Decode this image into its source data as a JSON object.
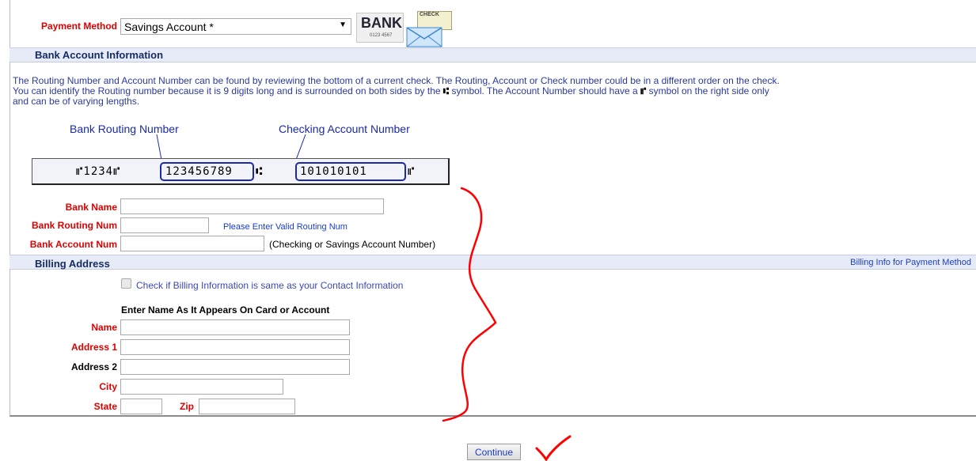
{
  "payment": {
    "label": "Payment Method",
    "selected": "Savings Account *",
    "bank_icon_text": "BANK",
    "bank_icon_subtext": "0123 4567",
    "check_icon_text": "CHECK"
  },
  "bank_section": {
    "title": "Bank Account Information",
    "info_line1": "The Routing Number and Account Number can be found by reviewing the bottom of a current check. The Routing, Account or Check number could be in a different order on the check.",
    "info_line2a": "You can identify the Routing number because it is 9 digits long and is surrounded on both sides by the",
    "info_line2b": "symbol. The Account Number should have a",
    "info_line2c": "symbol on the right side only",
    "info_line3": "and can be of varying lengths.",
    "routing_label": "Bank Routing Number",
    "account_label": "Checking Account Number",
    "micr_prefix": "⑈1234⑈",
    "micr_routing": "123456789",
    "micr_account": "101010101",
    "bank_name_label": "Bank Name",
    "bank_name_value": "",
    "routing_num_label": "Bank Routing Num",
    "routing_num_value": "",
    "routing_hint": "Please Enter Valid Routing Num",
    "account_num_label": "Bank Account Num",
    "account_num_value": "",
    "account_hint": "(Checking or Savings Account Number)"
  },
  "billing": {
    "title": "Billing Address",
    "right_note": "Billing Info for Payment Method",
    "same_as_contact": "Check if Billing Information is same as your Contact Information",
    "name_prompt": "Enter Name As It Appears On Card or Account",
    "name_label": "Name",
    "address1_label": "Address 1",
    "address2_label": "Address 2",
    "city_label": "City",
    "state_label": "State",
    "zip_label": "Zip"
  },
  "actions": {
    "continue_label": "Continue"
  },
  "colors": {
    "required_label": "#e00000",
    "section_bg": "#e7ebf7",
    "info_text": "#2a3a9c",
    "annotation_red": "#ff0000"
  }
}
